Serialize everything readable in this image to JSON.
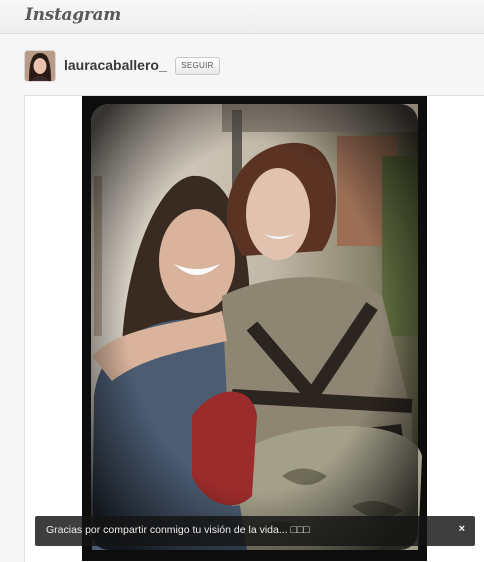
{
  "header": {
    "logo_text": "Instagram"
  },
  "profile": {
    "username": "lauracaballero_",
    "follow_label": "SEGUIR"
  },
  "post": {
    "caption": "Gracias por compartir conmigo tu visión de la vida... □□□",
    "close_label": "×"
  },
  "colors": {
    "caption_bg": "#141414",
    "photo_border": "#0d0d0d"
  }
}
